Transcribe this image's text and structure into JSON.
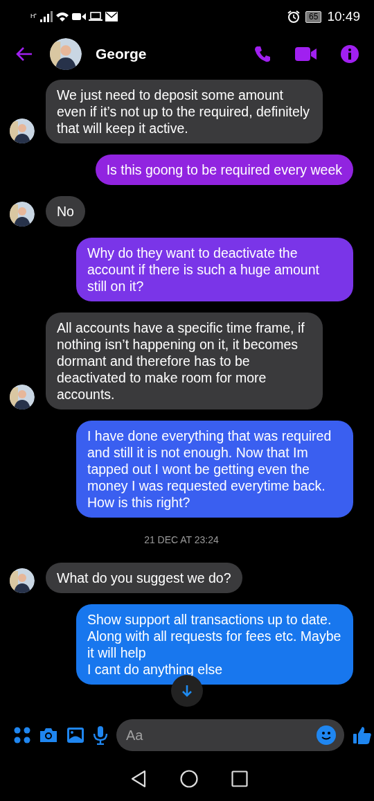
{
  "status_bar": {
    "network": "H⁺",
    "battery": "65",
    "time": "10:49"
  },
  "header": {
    "name": "George"
  },
  "messages": [
    {
      "kind": "incoming",
      "text": "We just need to deposit some amount even if it’s not up to the required, definitely that will keep it active.",
      "show_avatar": true
    },
    {
      "kind": "outgoing",
      "text": "Is this goong to be required every week",
      "color": "#9124e0"
    },
    {
      "kind": "incoming",
      "text": "No",
      "show_avatar": true
    },
    {
      "kind": "outgoing",
      "text": "Why do they want to deactivate the account if there is such a huge amount still on it?",
      "color": "#7a35e8"
    },
    {
      "kind": "incoming",
      "text": "All accounts have a specific time frame, if nothing isn’t happening on it, it becomes dormant and therefore has to be deactivated to make room for more accounts.",
      "show_avatar": true
    },
    {
      "kind": "outgoing",
      "text": "I have done everything that was required and still it is not enough. Now that Im tapped out I wont be getting even the money I was requested everytime back. How is this right?",
      "color": "#3a5ff0"
    },
    {
      "kind": "timestamp",
      "text": "21 DEC AT 23:24"
    },
    {
      "kind": "incoming",
      "text": "What do you suggest we do?",
      "show_avatar": true
    },
    {
      "kind": "outgoing",
      "text": "Show support all transactions up to date. Along with all requests for fees etc. Maybe it will help\nI cant do anything else",
      "color": "#1877ee"
    }
  ],
  "composer": {
    "placeholder": "Aa"
  }
}
